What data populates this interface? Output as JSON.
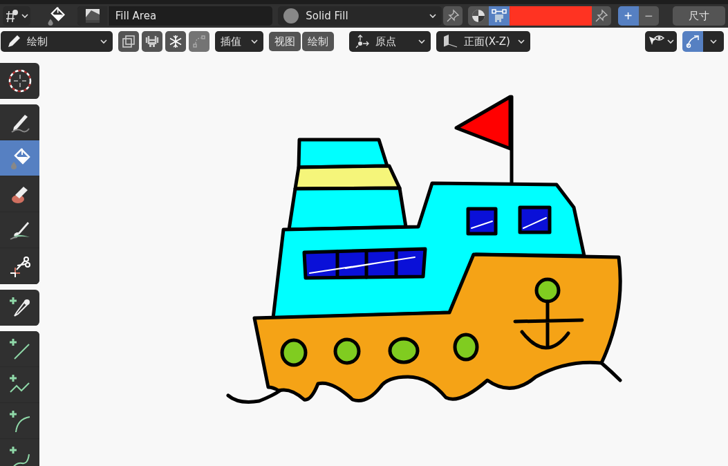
{
  "header": {
    "brush": {
      "name": "Fill Area"
    },
    "material": {
      "name": "Solid Fill"
    },
    "color_modes": [
      {
        "kind": "material",
        "selected": false
      },
      {
        "kind": "vertex",
        "selected": true
      }
    ],
    "color_swatch": {
      "color": "#ff3322"
    },
    "mix_modes": [
      {
        "label": "+",
        "selected": true
      },
      {
        "label": "−",
        "selected": false
      }
    ],
    "size_button": "尺寸"
  },
  "tool_settings": {
    "mode": "绘制",
    "interpolate": "插值",
    "menus": [
      "视图",
      "绘制"
    ],
    "pivot": "原点",
    "orientation": "正面(X-Z)",
    "overlay_toggle": {
      "selected": true
    }
  },
  "toolbar": [
    {
      "tools": [
        {
          "kind": "cursor",
          "selected": false
        }
      ]
    },
    {
      "tools": [
        {
          "kind": "draw",
          "selected": false
        },
        {
          "kind": "fill",
          "selected": true
        },
        {
          "kind": "erase",
          "selected": false
        },
        {
          "kind": "tint",
          "selected": false
        },
        {
          "kind": "cutter",
          "selected": false
        }
      ]
    },
    {
      "tools": [
        {
          "kind": "eyedropper",
          "selected": false
        }
      ]
    },
    {
      "tools": [
        {
          "kind": "line",
          "selected": false
        },
        {
          "kind": "polyline",
          "selected": false
        },
        {
          "kind": "arc",
          "selected": false
        },
        {
          "kind": "curve",
          "selected": false
        }
      ]
    }
  ]
}
